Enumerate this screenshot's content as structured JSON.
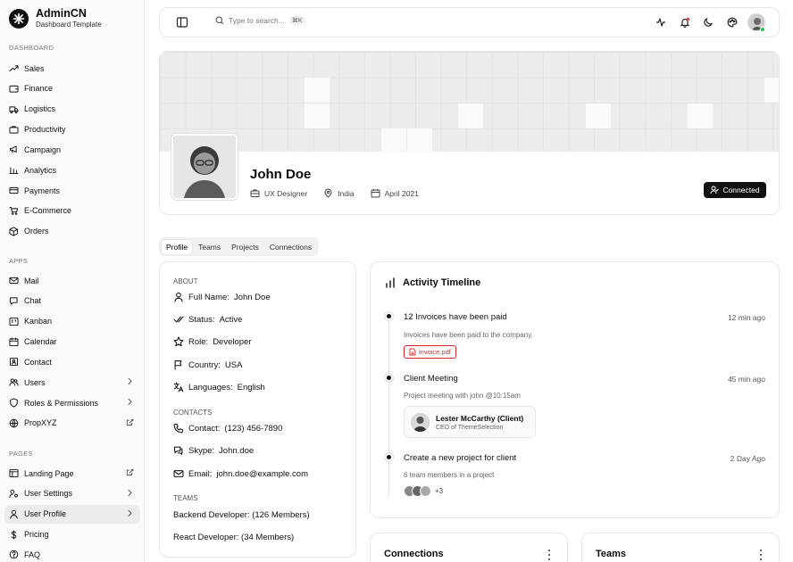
{
  "brand": {
    "name": "AdminCN",
    "subtitle": "Dashboard Template"
  },
  "sidebar": {
    "sections": [
      {
        "title": "DASHBOARD",
        "items": [
          {
            "label": "Sales",
            "icon": "trending-up-icon"
          },
          {
            "label": "Finance",
            "icon": "wallet-icon"
          },
          {
            "label": "Logistics",
            "icon": "truck-icon"
          },
          {
            "label": "Productivity",
            "icon": "briefcase-icon"
          },
          {
            "label": "Campaign",
            "icon": "megaphone-icon"
          },
          {
            "label": "Analytics",
            "icon": "bar-chart-icon"
          },
          {
            "label": "Payments",
            "icon": "credit-card-icon"
          },
          {
            "label": "E-Commerce",
            "icon": "cart-icon"
          },
          {
            "label": "Orders",
            "icon": "package-icon"
          }
        ]
      },
      {
        "title": "APPS",
        "items": [
          {
            "label": "Mail",
            "icon": "mail-icon"
          },
          {
            "label": "Chat",
            "icon": "chat-icon"
          },
          {
            "label": "Kanban",
            "icon": "kanban-icon"
          },
          {
            "label": "Calendar",
            "icon": "calendar-icon"
          },
          {
            "label": "Contact",
            "icon": "contact-icon"
          },
          {
            "label": "Users",
            "icon": "users-icon",
            "trail": "chevron-right-icon"
          },
          {
            "label": "Roles & Permissions",
            "icon": "shield-icon",
            "trail": "chevron-right-icon"
          },
          {
            "label": "PropXYZ",
            "icon": "globe-icon",
            "trail": "external-link-icon"
          }
        ]
      },
      {
        "title": "PAGES",
        "items": [
          {
            "label": "Landing Page",
            "icon": "layout-icon",
            "trail": "external-link-icon"
          },
          {
            "label": "User Settings",
            "icon": "user-cog-icon",
            "trail": "chevron-right-icon"
          },
          {
            "label": "User Profile",
            "icon": "user-icon",
            "trail": "chevron-right-icon",
            "active": true
          },
          {
            "label": "Pricing",
            "icon": "dollar-icon"
          },
          {
            "label": "FAQ",
            "icon": "help-icon"
          }
        ]
      }
    ]
  },
  "topbar": {
    "search_placeholder": "Type to search...",
    "shortcut": "⌘K"
  },
  "profile": {
    "name": "John Doe",
    "role": "UX Designer",
    "location": "India",
    "joined": "April 2021",
    "connected_label": "Connected"
  },
  "tabs": [
    "Profile",
    "Teams",
    "Projects",
    "Connections"
  ],
  "about": {
    "about_title": "ABOUT",
    "fields": [
      {
        "key": "Full Name:",
        "value": "John Doe",
        "icon": "user-icon"
      },
      {
        "key": "Status:",
        "value": "Active",
        "icon": "check-double-icon"
      },
      {
        "key": "Role:",
        "value": "Developer",
        "icon": "star-icon"
      },
      {
        "key": "Country:",
        "value": "USA",
        "icon": "flag-icon"
      },
      {
        "key": "Languages:",
        "value": "English",
        "icon": "language-icon"
      }
    ],
    "contacts_title": "CONTACTS",
    "contacts": [
      {
        "key": "Contact:",
        "value": "(123) 456-7890",
        "icon": "phone-icon"
      },
      {
        "key": "Skype:",
        "value": "John.doe",
        "icon": "message-icon"
      },
      {
        "key": "Email:",
        "value": "john.doe@example.com",
        "icon": "mail-icon"
      }
    ],
    "teams_title": "TEAMS",
    "teams": [
      {
        "name": "Backend Developer:",
        "members": "(126 Members)"
      },
      {
        "name": "React Developer:",
        "members": "(34 Members)"
      }
    ]
  },
  "timeline": {
    "title": "Activity Timeline",
    "events": [
      {
        "title": "12 Invoices have been paid",
        "time": "12 min ago",
        "desc": "Invoices have been paid to the company.",
        "attachment": "invoice.pdf"
      },
      {
        "title": "Client Meeting",
        "time": "45 min ago",
        "desc": "Project meeting with john @10:15am",
        "person_name": "Lester McCarthy (Client)",
        "person_role": "CEO of ThemeSelection"
      },
      {
        "title": "Create a new project for client",
        "time": "2 Day Ago",
        "desc": "6 team members in a project",
        "more": "+3"
      }
    ]
  },
  "connections": {
    "title": "Connections"
  },
  "teams_card": {
    "title": "Teams"
  },
  "colors": {
    "accent": "#111111",
    "pdf": "#dc2626",
    "online": "#22c55e",
    "notify": "#ef4444"
  }
}
